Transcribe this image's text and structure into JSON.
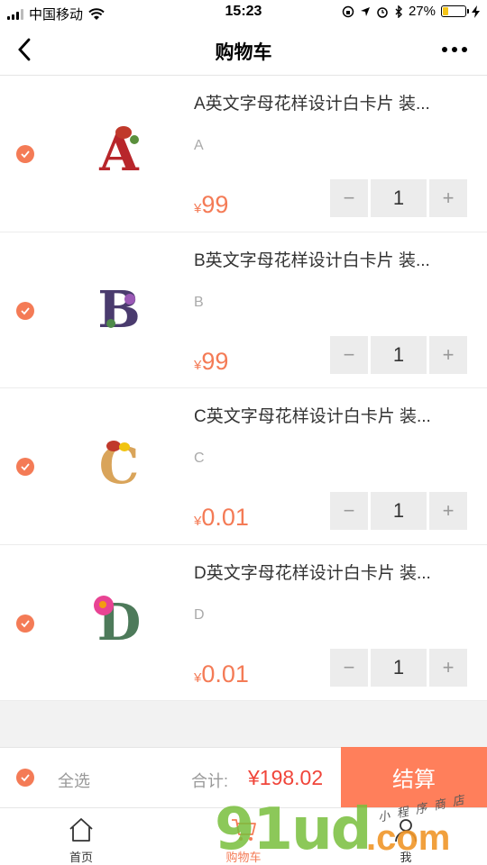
{
  "status_bar": {
    "carrier": "中国移动",
    "time": "15:23",
    "battery": "27%",
    "battery_level": 0.27
  },
  "nav": {
    "title": "购物车"
  },
  "cart": {
    "items": [
      {
        "title": "A英文字母花样设计白卡片 装...",
        "spec": "A",
        "currency": "¥",
        "price": "99",
        "qty": "1",
        "letter": "A",
        "letter_color": "#b8262b",
        "checked": true
      },
      {
        "title": "B英文字母花样设计白卡片 装...",
        "spec": "B",
        "currency": "¥",
        "price": "99",
        "qty": "1",
        "letter": "B",
        "letter_color": "#4a3b6e",
        "checked": true
      },
      {
        "title": "C英文字母花样设计白卡片 装...",
        "spec": "C",
        "currency": "¥",
        "price": "0.01",
        "qty": "1",
        "letter": "C",
        "letter_color": "#d9a45a",
        "checked": true
      },
      {
        "title": "D英文字母花样设计白卡片 装...",
        "spec": "D",
        "currency": "¥",
        "price": "0.01",
        "qty": "1",
        "letter": "D",
        "letter_color": "#4d7a5a",
        "checked": true
      }
    ],
    "minus": "−",
    "plus": "+"
  },
  "checkout": {
    "select_all": "全选",
    "total_label": "合计:",
    "total_value": "¥198.02",
    "button": "结算"
  },
  "tabs": [
    {
      "label": "首页",
      "icon": "home-icon",
      "active": false
    },
    {
      "label": "购物车",
      "icon": "cart-icon",
      "active": true
    },
    {
      "label": "我",
      "icon": "user-icon",
      "active": false
    }
  ],
  "watermark": {
    "main": "91ud",
    "suffix": ".com",
    "sub": "小程序商店"
  },
  "colors": {
    "accent": "#f47b56",
    "checkout_button": "#ff7f5b",
    "total": "#f0453a"
  }
}
